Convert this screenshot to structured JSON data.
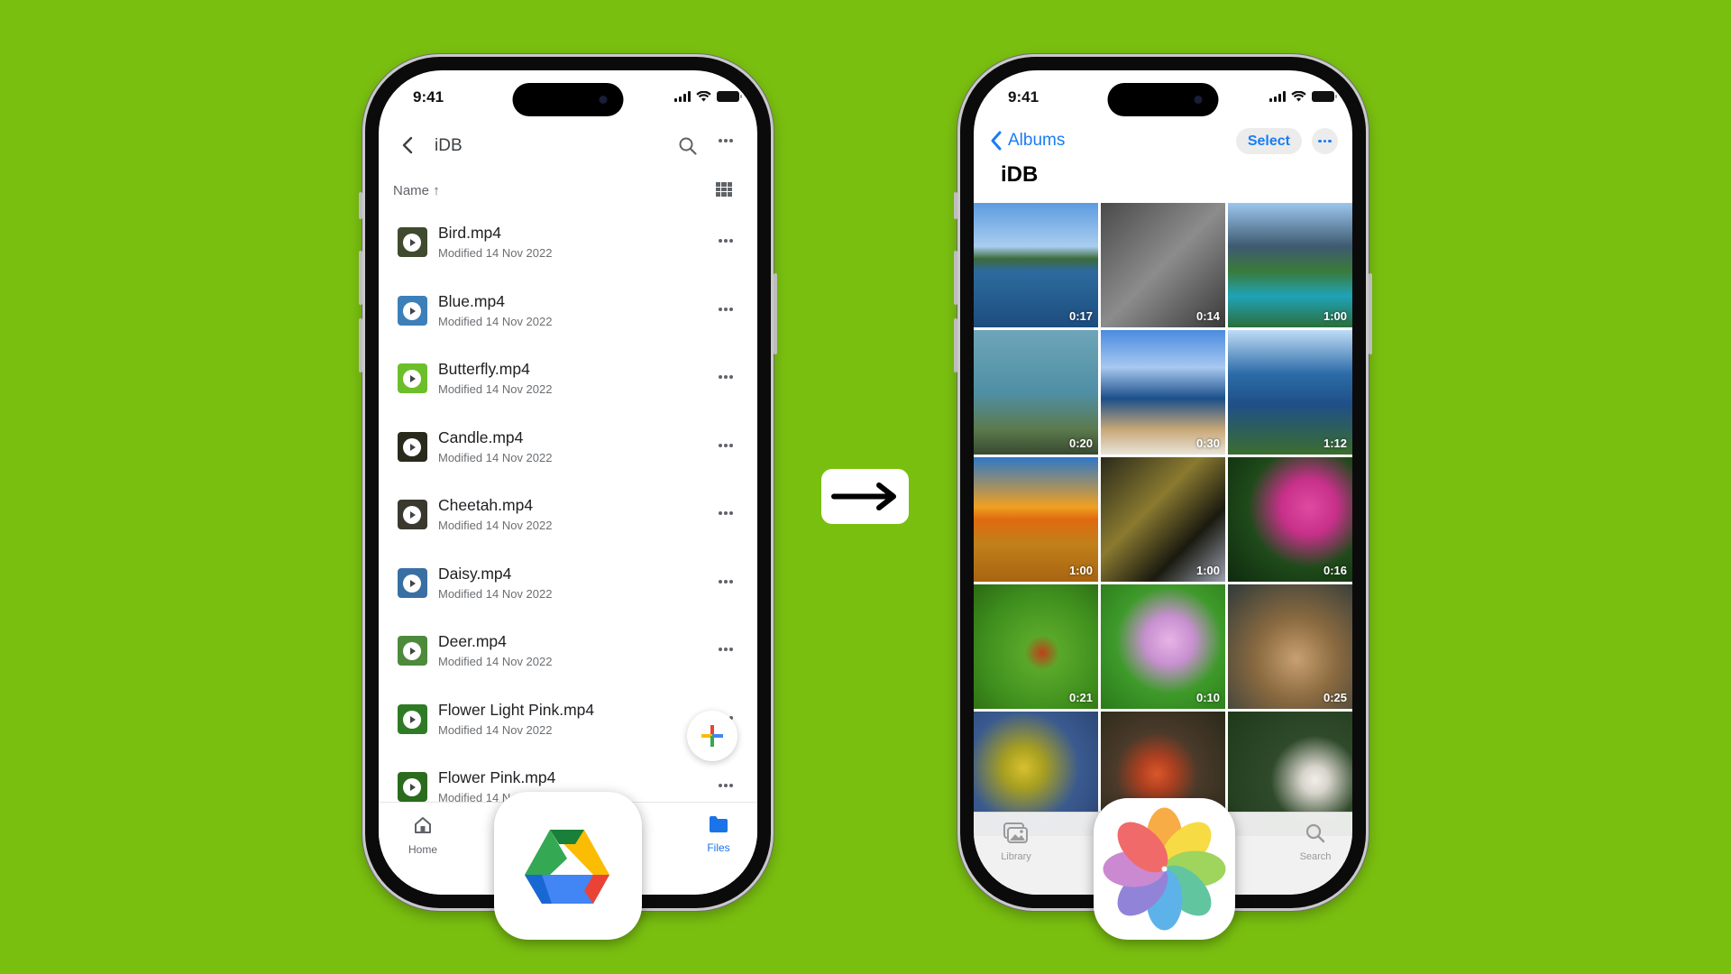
{
  "status_bar": {
    "time": "9:41"
  },
  "drive": {
    "header": {
      "title": "iDB",
      "back_icon": "chevron-left-icon",
      "search_icon": "search-icon",
      "more_icon": "more-horizontal-icon"
    },
    "sort": {
      "label": "Name",
      "direction_icon": "arrow-up-icon",
      "direction_glyph": "↑",
      "view_toggle_icon": "grid-view-icon"
    },
    "files": [
      {
        "name": "Bird.mp4",
        "modified": "Modified 14 Nov 2022",
        "thumb_color": "#3f4a2e"
      },
      {
        "name": "Blue.mp4",
        "modified": "Modified 14 Nov 2022",
        "thumb_color": "#3d7fb8"
      },
      {
        "name": "Butterfly.mp4",
        "modified": "Modified 14 Nov 2022",
        "thumb_color": "#6cbf2a"
      },
      {
        "name": "Candle.mp4",
        "modified": "Modified 14 Nov 2022",
        "thumb_color": "#2a2a1c"
      },
      {
        "name": "Cheetah.mp4",
        "modified": "Modified 14 Nov 2022",
        "thumb_color": "#3b3830"
      },
      {
        "name": "Daisy.mp4",
        "modified": "Modified 14 Nov 2022",
        "thumb_color": "#3a6fa3"
      },
      {
        "name": "Deer.mp4",
        "modified": "Modified 14 Nov 2022",
        "thumb_color": "#4d8a3c"
      },
      {
        "name": "Flower Light Pink.mp4",
        "modified": "Modified 14 Nov 2022",
        "thumb_color": "#2f7a24"
      },
      {
        "name": "Flower Pink.mp4",
        "modified": "Modified 14 Nov 2022",
        "thumb_color": "#2a6b1e"
      }
    ],
    "fab_icon": "plus-icon",
    "tabs": [
      {
        "label": "Home",
        "icon": "home-icon",
        "active": false
      },
      {
        "label": "Files",
        "icon": "folder-icon",
        "active": true
      }
    ],
    "colors": {
      "active": "#1a73e8",
      "inactive": "#5f6368"
    }
  },
  "middle": {
    "arrow_icon": "arrow-right-icon"
  },
  "photos": {
    "nav": {
      "back_label": "Albums",
      "select_label": "Select",
      "more_icon": "more-horizontal-icon"
    },
    "title": "iDB",
    "grid": [
      {
        "duration": "0:17",
        "bg": "linear-gradient(#5d9be0 0%, #a9cdf0 35%, #3b6b3a 45%, #2e6a9e 55%, #1c4d7e 100%)"
      },
      {
        "duration": "0:14",
        "bg": "linear-gradient(135deg, #4a4a4a, #8c8c8c 50%, #3a3a3a)"
      },
      {
        "duration": "1:00",
        "bg": "linear-gradient(#9cc6ee 0%, #3e5a70 35%, #3a7a3a 55%, #1fa3b8 75%, #2b6e3a 100%)"
      },
      {
        "duration": "0:20",
        "bg": "linear-gradient(#6fa5b8 0%, #4f8fa6 50%, #5b7a4c 80%, #384a30 100%)"
      },
      {
        "duration": "0:30",
        "bg": "linear-gradient(#4a8be0 0%, #a8c8f0 30%, #1b4f8a 55%, #c9a878 80%, #e8e4d8 100%)"
      },
      {
        "duration": "1:12",
        "bg": "linear-gradient(#bfdcf6 0%, #2c6ca8 35%, #1f4f86 60%, #3b6e2e 100%)"
      },
      {
        "duration": "1:00",
        "bg": "linear-gradient(#2f78c8 0%, #f0a020 40%, #e06a10 50%, #c0801a 70%, #a86412 100%)"
      },
      {
        "duration": "1:00",
        "bg": "linear-gradient(135deg, #2a2a1a, #8a7a30 40%, #1a1a10 70%, #9aa0b0 100%)"
      },
      {
        "duration": "0:16",
        "bg": "radial-gradient(circle at 65% 40%, #e04aa0 0%, #c8308a 25%, #1f4a1a 55%, #0f2a0f 100%)"
      },
      {
        "duration": "0:21",
        "bg": "radial-gradient(circle at 55% 55%, #c0401a 0%, #5aa82a 18%, #3f8f1e 60%, #2b6a12 100%)"
      },
      {
        "duration": "0:10",
        "bg": "radial-gradient(circle at 55% 45%, #e6b4e6 0%, #c890d0 25%, #3e9a2a 55%, #2b7a1a 100%)"
      },
      {
        "duration": "0:25",
        "bg": "radial-gradient(circle at 55% 60%, #c8a070 0%, #8a6a40 40%, #2f3a3a 100%)"
      },
      {
        "duration": "",
        "bg": "radial-gradient(circle at 40% 45%, #d8c030 0%, #a8a020 20%, #3a5a90 55%, #2a4470 100%)"
      },
      {
        "duration": "",
        "bg": "radial-gradient(circle at 45% 50%, #d8582a 0%, #b04020 18%, #4a3a2a 45%, #2a2a1a 100%)"
      },
      {
        "duration": "",
        "bg": "radial-gradient(circle at 70% 55%, #f0eee8 0%, #d8d4cc 12%, #2f4a2a 40%, #1f3a1a 100%)"
      }
    ],
    "tabs": [
      {
        "label": "Library",
        "icon": "photo-library-icon"
      },
      {
        "label": "Search",
        "icon": "search-icon"
      }
    ],
    "colors": {
      "accent": "#1a7cf5"
    }
  },
  "app_icons": {
    "drive": {
      "name": "Google Drive",
      "colors": [
        "#0f9d58",
        "#f4b400",
        "#4285f4",
        "#1967d2",
        "#ea4335",
        "#188038"
      ]
    },
    "photos": {
      "name": "Photos"
    }
  }
}
